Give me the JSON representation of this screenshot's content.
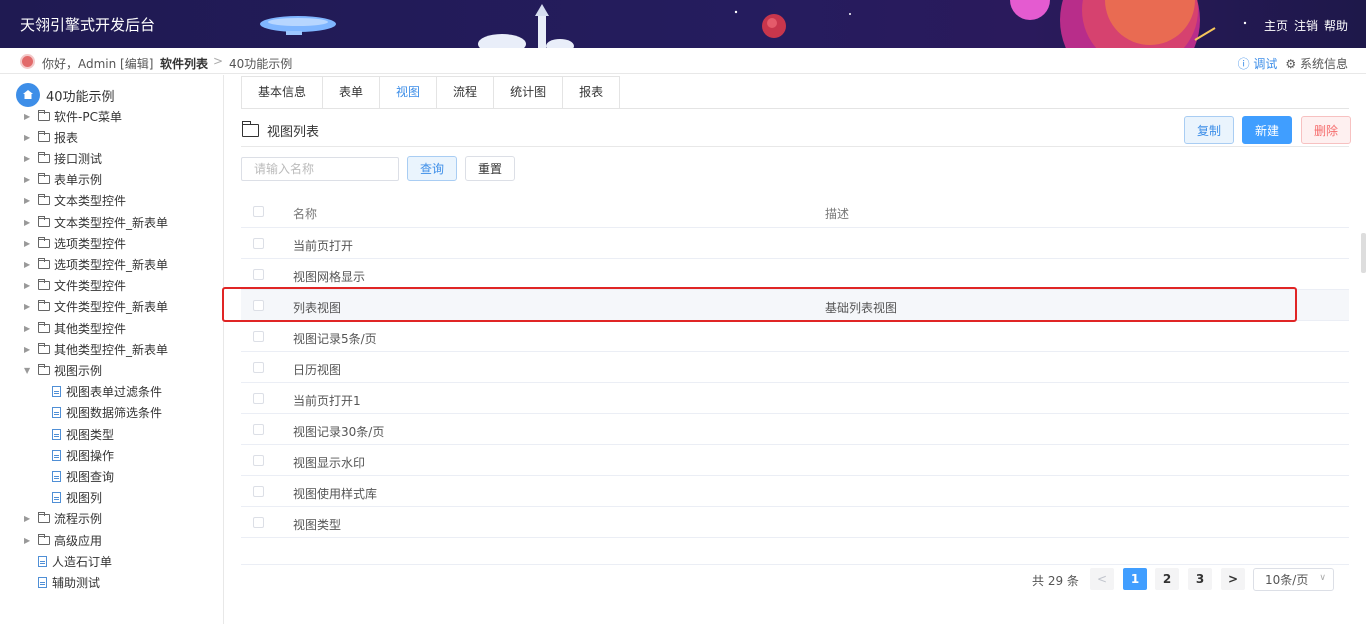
{
  "header": {
    "brand": "天翎引擎式开发后台",
    "links": [
      "主页",
      "注销",
      "帮助"
    ]
  },
  "crumbbar": {
    "greeting": "你好，Admin [编辑]",
    "app": "软件列表",
    "separator": ">",
    "current": "40功能示例",
    "debug": "ⓘ 调试",
    "system": "⚙ 系统信息"
  },
  "sidebar": {
    "root": "40功能示例",
    "items": [
      {
        "label": "软件-PC菜单",
        "type": "folder"
      },
      {
        "label": "报表",
        "type": "folder"
      },
      {
        "label": "接口测试",
        "type": "folder"
      },
      {
        "label": "表单示例",
        "type": "folder"
      },
      {
        "label": "文本类型控件",
        "type": "folder"
      },
      {
        "label": "文本类型控件_新表单",
        "type": "folder"
      },
      {
        "label": "选项类型控件",
        "type": "folder"
      },
      {
        "label": "选项类型控件_新表单",
        "type": "folder"
      },
      {
        "label": "文件类型控件",
        "type": "folder"
      },
      {
        "label": "文件类型控件_新表单",
        "type": "folder"
      },
      {
        "label": "其他类型控件",
        "type": "folder"
      },
      {
        "label": "其他类型控件_新表单",
        "type": "folder"
      },
      {
        "label": "视图示例",
        "type": "folder-open"
      },
      {
        "label": "视图表单过滤条件",
        "type": "doc-child"
      },
      {
        "label": "视图数据筛选条件",
        "type": "doc-child"
      },
      {
        "label": "视图类型",
        "type": "doc-child"
      },
      {
        "label": "视图操作",
        "type": "doc-child"
      },
      {
        "label": "视图查询",
        "type": "doc-child"
      },
      {
        "label": "视图列",
        "type": "doc-child"
      },
      {
        "label": "流程示例",
        "type": "folder"
      },
      {
        "label": "高级应用",
        "type": "folder"
      },
      {
        "label": "人造石订单",
        "type": "doc"
      },
      {
        "label": "辅助测试",
        "type": "doc"
      }
    ]
  },
  "tabs": [
    {
      "label": "基本信息",
      "active": false
    },
    {
      "label": "表单",
      "active": false
    },
    {
      "label": "视图",
      "active": true
    },
    {
      "label": "流程",
      "active": false
    },
    {
      "label": "统计图",
      "active": false
    },
    {
      "label": "报表",
      "active": false
    }
  ],
  "list": {
    "title": "视图列表",
    "copy": "复制",
    "new": "新建",
    "delete": "删除",
    "search_placeholder": "请输入名称",
    "query": "查询",
    "reset": "重置"
  },
  "table": {
    "columns": [
      "名称",
      "描述"
    ],
    "rows": [
      {
        "name": "当前页打开",
        "desc": ""
      },
      {
        "name": "视图网格显示",
        "desc": ""
      },
      {
        "name": "列表视图",
        "desc": "基础列表视图"
      },
      {
        "name": "视图记录5条/页",
        "desc": ""
      },
      {
        "name": "日历视图",
        "desc": ""
      },
      {
        "name": "当前页打开1",
        "desc": ""
      },
      {
        "name": "视图记录30条/页",
        "desc": ""
      },
      {
        "name": "视图显示水印",
        "desc": ""
      },
      {
        "name": "视图使用样式库",
        "desc": ""
      },
      {
        "name": "视图类型",
        "desc": ""
      }
    ],
    "highlighted_row": 2
  },
  "pagination": {
    "total": "共 29 条",
    "prev": "<",
    "next": ">",
    "pages": [
      "1",
      "2",
      "3"
    ],
    "current": "1",
    "page_size": "10条/页"
  },
  "colors": {
    "accent": "#409eff",
    "danger": "#f56c6c",
    "highlight_box": "#e02525"
  }
}
